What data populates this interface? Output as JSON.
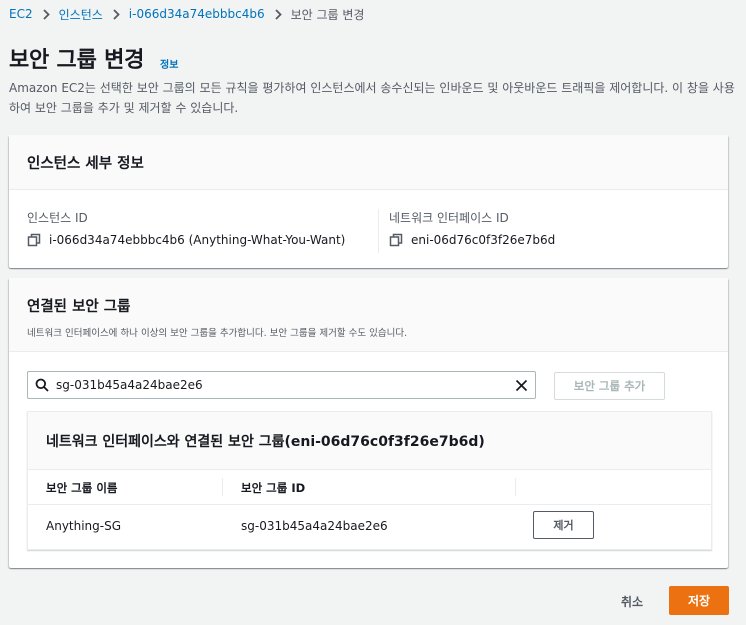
{
  "breadcrumb": {
    "items": [
      {
        "label": "EC2"
      },
      {
        "label": "인스턴스"
      },
      {
        "label": "i-066d34a74ebbbc4b6"
      },
      {
        "label": "보안 그룹 변경"
      }
    ]
  },
  "header": {
    "title": "보안 그룹 변경",
    "info_link": "정보",
    "description": "Amazon EC2는 선택한 보안 그룹의 모든 규칙을 평가하여 인스턴스에서 송수신되는 인바운드 및 아웃바운드 트래픽을 제어합니다. 이 창을 사용하여 보안 그룹을 추가 및 제거할 수 있습니다."
  },
  "instance_details": {
    "title": "인스턴스 세부 정보",
    "instance_id_label": "인스턴스 ID",
    "instance_id_value": "i-066d34a74ebbbc4b6 (Anything-What-You-Want)",
    "eni_label": "네트워크 인터페이스 ID",
    "eni_value": "eni-06d76c0f3f26e7b6d"
  },
  "associated_groups": {
    "title": "연결된 보안 그룹",
    "description": "네트워크 인터페이스에 하나 이상의 보안 그룹을 추가합니다. 보안 그룹을 제거할 수도 있습니다.",
    "search_value": "sg-031b45a4a24bae2e6",
    "add_button": "보안 그룹 추가",
    "table": {
      "title": "네트워크 인터페이스와 연결된 보안 그룹(eni-06d76c0f3f26e7b6d)",
      "columns": [
        "보안 그룹 이름",
        "보안 그룹 ID"
      ],
      "rows": [
        {
          "name": "Anything-SG",
          "id": "sg-031b45a4a24bae2e6",
          "action": "제거"
        }
      ]
    }
  },
  "footer": {
    "cancel_label": "취소",
    "save_label": "저장"
  },
  "colors": {
    "link": "#0073bb",
    "primary_button": "#ec7211",
    "background": "#f2f3f3"
  }
}
